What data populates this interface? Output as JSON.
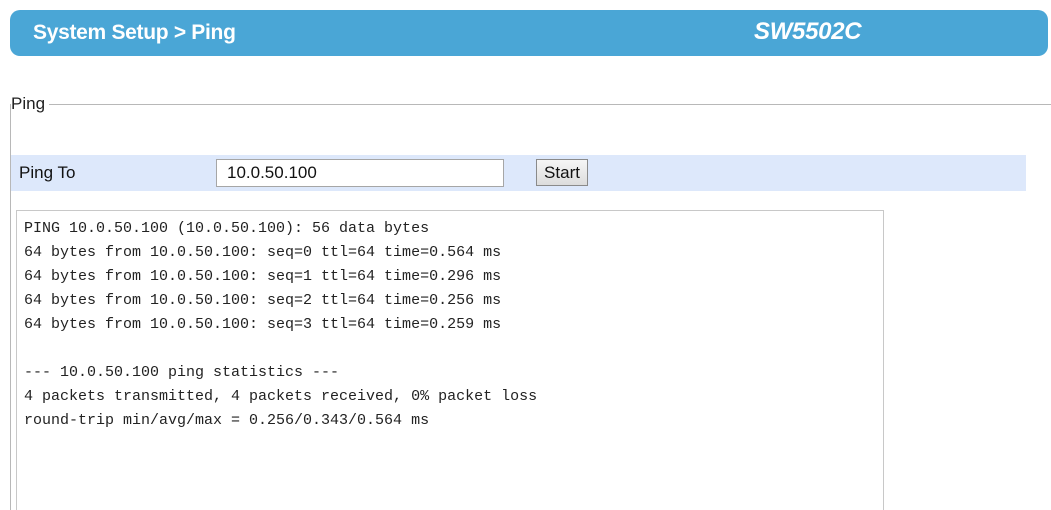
{
  "header": {
    "breadcrumb": "System Setup > Ping",
    "model": "SW5502C"
  },
  "ping_section": {
    "legend": "Ping",
    "ping_to_label": "Ping To",
    "ping_to_value": "10.0.50.100",
    "start_button_label": "Start"
  },
  "output": {
    "lines": [
      "PING 10.0.50.100 (10.0.50.100): 56 data bytes",
      "64 bytes from 10.0.50.100: seq=0 ttl=64 time=0.564 ms",
      "64 bytes from 10.0.50.100: seq=1 ttl=64 time=0.296 ms",
      "64 bytes from 10.0.50.100: seq=2 ttl=64 time=0.256 ms",
      "64 bytes from 10.0.50.100: seq=3 ttl=64 time=0.259 ms",
      "",
      "--- 10.0.50.100 ping statistics ---",
      "4 packets transmitted, 4 packets received, 0% packet loss",
      "round-trip min/avg/max = 0.256/0.343/0.564 ms"
    ]
  },
  "colors": {
    "header_bar": "#4aa6d6",
    "ping_row_background": "#dde8fb"
  }
}
